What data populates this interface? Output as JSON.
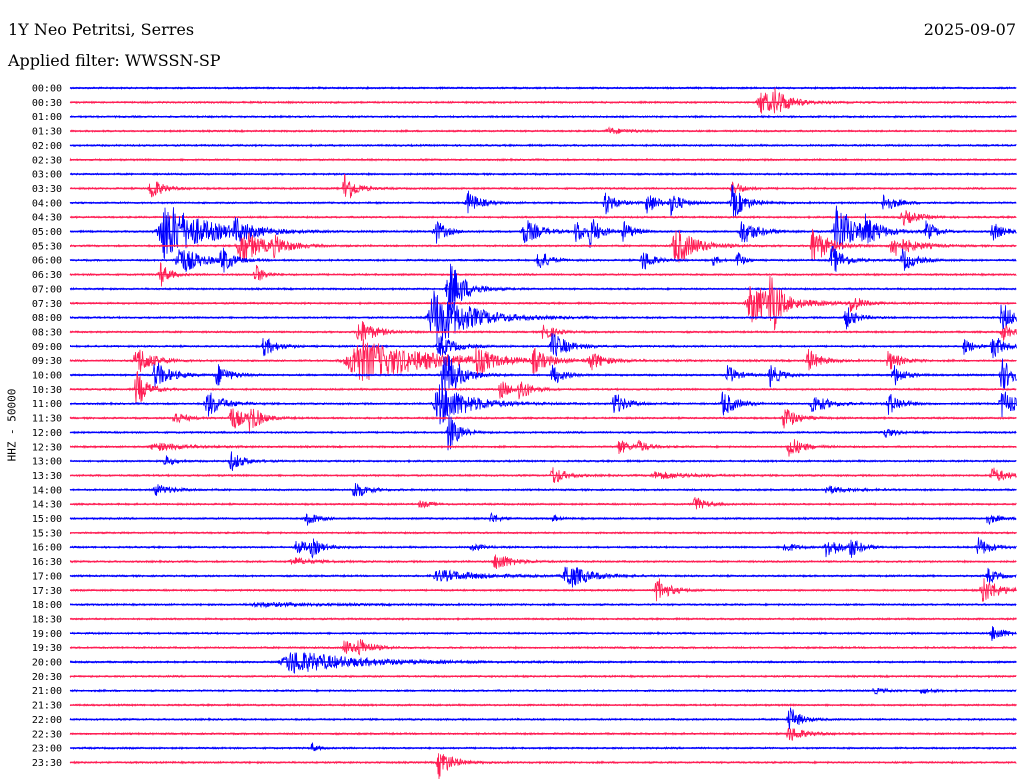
{
  "header": {
    "station": "1Y Neo Petritsi, Serres",
    "date": "2025-09-07",
    "filter": "Applied filter: WWSSN-SP"
  },
  "colors": {
    "odd": "#0000ff",
    "even": "#ff1f55"
  },
  "chart_data": {
    "type": "helicorder",
    "ylabel": "HHZ - 50000",
    "rows": [
      {
        "time": "00:00",
        "events": []
      },
      {
        "time": "00:30",
        "events": [
          {
            "x": 0.73,
            "amp": 12,
            "w": 0.02
          },
          {
            "x": 0.745,
            "amp": 10,
            "w": 0.012
          }
        ]
      },
      {
        "time": "01:00",
        "events": []
      },
      {
        "time": "01:30",
        "events": [
          {
            "x": 0.57,
            "amp": 3,
            "w": 0.02
          }
        ]
      },
      {
        "time": "02:00",
        "events": []
      },
      {
        "time": "02:30",
        "events": []
      },
      {
        "time": "03:00",
        "events": []
      },
      {
        "time": "03:30",
        "events": [
          {
            "x": 0.085,
            "amp": 14,
            "w": 0.01
          },
          {
            "x": 0.29,
            "amp": 18,
            "w": 0.01
          },
          {
            "x": 0.7,
            "amp": 8,
            "w": 0.01
          }
        ]
      },
      {
        "time": "04:00",
        "events": [
          {
            "x": 0.42,
            "amp": 12,
            "w": 0.012
          },
          {
            "x": 0.565,
            "amp": 14,
            "w": 0.01
          },
          {
            "x": 0.61,
            "amp": 12,
            "w": 0.01
          },
          {
            "x": 0.635,
            "amp": 12,
            "w": 0.01
          },
          {
            "x": 0.7,
            "amp": 18,
            "w": 0.012
          },
          {
            "x": 0.86,
            "amp": 10,
            "w": 0.012
          }
        ]
      },
      {
        "time": "04:30",
        "events": [
          {
            "x": 0.88,
            "amp": 8,
            "w": 0.015
          }
        ]
      },
      {
        "time": "05:00",
        "events": [
          {
            "x": 0.1,
            "amp": 30,
            "w": 0.04
          },
          {
            "x": 0.175,
            "amp": 10,
            "w": 0.015
          },
          {
            "x": 0.385,
            "amp": 14,
            "w": 0.01
          },
          {
            "x": 0.48,
            "amp": 14,
            "w": 0.015
          },
          {
            "x": 0.535,
            "amp": 12,
            "w": 0.01
          },
          {
            "x": 0.55,
            "amp": 14,
            "w": 0.01
          },
          {
            "x": 0.585,
            "amp": 10,
            "w": 0.01
          },
          {
            "x": 0.71,
            "amp": 14,
            "w": 0.015
          },
          {
            "x": 0.81,
            "amp": 30,
            "w": 0.018
          },
          {
            "x": 0.84,
            "amp": 12,
            "w": 0.015
          },
          {
            "x": 0.905,
            "amp": 10,
            "w": 0.01
          },
          {
            "x": 0.975,
            "amp": 10,
            "w": 0.01
          }
        ]
      },
      {
        "time": "05:30",
        "events": [
          {
            "x": 0.18,
            "amp": 20,
            "w": 0.02
          },
          {
            "x": 0.215,
            "amp": 8,
            "w": 0.015
          },
          {
            "x": 0.64,
            "amp": 20,
            "w": 0.02
          },
          {
            "x": 0.785,
            "amp": 20,
            "w": 0.015
          },
          {
            "x": 0.87,
            "amp": 12,
            "w": 0.02
          }
        ]
      },
      {
        "time": "06:00",
        "events": [
          {
            "x": 0.115,
            "amp": 16,
            "w": 0.02
          },
          {
            "x": 0.16,
            "amp": 14,
            "w": 0.01
          },
          {
            "x": 0.495,
            "amp": 12,
            "w": 0.01
          },
          {
            "x": 0.605,
            "amp": 12,
            "w": 0.01
          },
          {
            "x": 0.68,
            "amp": 6,
            "w": 0.005
          },
          {
            "x": 0.705,
            "amp": 10,
            "w": 0.006
          },
          {
            "x": 0.805,
            "amp": 16,
            "w": 0.012
          },
          {
            "x": 0.88,
            "amp": 12,
            "w": 0.012
          }
        ]
      },
      {
        "time": "06:30",
        "events": [
          {
            "x": 0.095,
            "amp": 14,
            "w": 0.008
          },
          {
            "x": 0.195,
            "amp": 12,
            "w": 0.008
          }
        ]
      },
      {
        "time": "07:00",
        "events": [
          {
            "x": 0.4,
            "amp": 30,
            "w": 0.015
          }
        ]
      },
      {
        "time": "07:30",
        "events": [
          {
            "x": 0.72,
            "amp": 20,
            "w": 0.03
          },
          {
            "x": 0.74,
            "amp": 40,
            "w": 0.006
          },
          {
            "x": 0.825,
            "amp": 10,
            "w": 0.01
          }
        ]
      },
      {
        "time": "08:00",
        "events": [
          {
            "x": 0.385,
            "amp": 30,
            "w": 0.035
          },
          {
            "x": 0.82,
            "amp": 12,
            "w": 0.01
          },
          {
            "x": 0.985,
            "amp": 16,
            "w": 0.012
          }
        ]
      },
      {
        "time": "08:30",
        "events": [
          {
            "x": 0.305,
            "amp": 14,
            "w": 0.015
          },
          {
            "x": 0.5,
            "amp": 10,
            "w": 0.01
          },
          {
            "x": 0.985,
            "amp": 10,
            "w": 0.01
          }
        ]
      },
      {
        "time": "09:00",
        "events": [
          {
            "x": 0.205,
            "amp": 10,
            "w": 0.012
          },
          {
            "x": 0.39,
            "amp": 12,
            "w": 0.015
          },
          {
            "x": 0.51,
            "amp": 14,
            "w": 0.015
          },
          {
            "x": 0.945,
            "amp": 8,
            "w": 0.01
          },
          {
            "x": 0.975,
            "amp": 14,
            "w": 0.01
          }
        ]
      },
      {
        "time": "09:30",
        "events": [
          {
            "x": 0.07,
            "amp": 16,
            "w": 0.015
          },
          {
            "x": 0.305,
            "amp": 22,
            "w": 0.07
          },
          {
            "x": 0.43,
            "amp": 14,
            "w": 0.012
          },
          {
            "x": 0.49,
            "amp": 12,
            "w": 0.012
          },
          {
            "x": 0.55,
            "amp": 10,
            "w": 0.012
          },
          {
            "x": 0.78,
            "amp": 12,
            "w": 0.012
          },
          {
            "x": 0.865,
            "amp": 10,
            "w": 0.012
          }
        ]
      },
      {
        "time": "10:00",
        "events": [
          {
            "x": 0.09,
            "amp": 14,
            "w": 0.015
          },
          {
            "x": 0.155,
            "amp": 12,
            "w": 0.012
          },
          {
            "x": 0.395,
            "amp": 30,
            "w": 0.015
          },
          {
            "x": 0.51,
            "amp": 12,
            "w": 0.01
          },
          {
            "x": 0.695,
            "amp": 10,
            "w": 0.01
          },
          {
            "x": 0.74,
            "amp": 12,
            "w": 0.01
          },
          {
            "x": 0.87,
            "amp": 12,
            "w": 0.01
          },
          {
            "x": 0.985,
            "amp": 16,
            "w": 0.015
          }
        ]
      },
      {
        "time": "10:30",
        "events": [
          {
            "x": 0.07,
            "amp": 20,
            "w": 0.01
          },
          {
            "x": 0.455,
            "amp": 10,
            "w": 0.01
          },
          {
            "x": 0.475,
            "amp": 12,
            "w": 0.01
          }
        ]
      },
      {
        "time": "11:00",
        "events": [
          {
            "x": 0.145,
            "amp": 14,
            "w": 0.015
          },
          {
            "x": 0.39,
            "amp": 22,
            "w": 0.03
          },
          {
            "x": 0.575,
            "amp": 12,
            "w": 0.012
          },
          {
            "x": 0.69,
            "amp": 14,
            "w": 0.012
          },
          {
            "x": 0.785,
            "amp": 10,
            "w": 0.015
          },
          {
            "x": 0.865,
            "amp": 12,
            "w": 0.012
          },
          {
            "x": 0.985,
            "amp": 14,
            "w": 0.015
          }
        ]
      },
      {
        "time": "11:30",
        "events": [
          {
            "x": 0.11,
            "amp": 8,
            "w": 0.01
          },
          {
            "x": 0.17,
            "amp": 14,
            "w": 0.012
          },
          {
            "x": 0.19,
            "amp": 14,
            "w": 0.01
          },
          {
            "x": 0.755,
            "amp": 12,
            "w": 0.012
          }
        ]
      },
      {
        "time": "12:00",
        "events": [
          {
            "x": 0.4,
            "amp": 20,
            "w": 0.01
          },
          {
            "x": 0.86,
            "amp": 6,
            "w": 0.01
          }
        ]
      },
      {
        "time": "12:30",
        "events": [
          {
            "x": 0.09,
            "amp": 4,
            "w": 0.03
          },
          {
            "x": 0.58,
            "amp": 8,
            "w": 0.01
          },
          {
            "x": 0.6,
            "amp": 6,
            "w": 0.01
          },
          {
            "x": 0.76,
            "amp": 12,
            "w": 0.012
          }
        ]
      },
      {
        "time": "13:00",
        "events": [
          {
            "x": 0.1,
            "amp": 6,
            "w": 0.008
          },
          {
            "x": 0.17,
            "amp": 10,
            "w": 0.012
          }
        ]
      },
      {
        "time": "13:30",
        "events": [
          {
            "x": 0.51,
            "amp": 10,
            "w": 0.012
          },
          {
            "x": 0.62,
            "amp": 4,
            "w": 0.03
          },
          {
            "x": 0.975,
            "amp": 8,
            "w": 0.015
          }
        ]
      },
      {
        "time": "14:00",
        "events": [
          {
            "x": 0.09,
            "amp": 6,
            "w": 0.015
          },
          {
            "x": 0.3,
            "amp": 10,
            "w": 0.012
          },
          {
            "x": 0.8,
            "amp": 4,
            "w": 0.02
          }
        ]
      },
      {
        "time": "14:30",
        "events": [
          {
            "x": 0.37,
            "amp": 4,
            "w": 0.01
          },
          {
            "x": 0.66,
            "amp": 8,
            "w": 0.01
          }
        ]
      },
      {
        "time": "15:00",
        "events": [
          {
            "x": 0.25,
            "amp": 8,
            "w": 0.01
          },
          {
            "x": 0.445,
            "amp": 6,
            "w": 0.008
          },
          {
            "x": 0.51,
            "amp": 4,
            "w": 0.005
          },
          {
            "x": 0.97,
            "amp": 6,
            "w": 0.01
          }
        ]
      },
      {
        "time": "15:30",
        "events": []
      },
      {
        "time": "16:00",
        "events": [
          {
            "x": 0.24,
            "amp": 8,
            "w": 0.012
          },
          {
            "x": 0.255,
            "amp": 8,
            "w": 0.01
          },
          {
            "x": 0.425,
            "amp": 4,
            "w": 0.01
          },
          {
            "x": 0.755,
            "amp": 6,
            "w": 0.01
          },
          {
            "x": 0.8,
            "amp": 12,
            "w": 0.012
          },
          {
            "x": 0.825,
            "amp": 10,
            "w": 0.01
          },
          {
            "x": 0.96,
            "amp": 10,
            "w": 0.012
          }
        ]
      },
      {
        "time": "16:30",
        "events": [
          {
            "x": 0.235,
            "amp": 4,
            "w": 0.02
          },
          {
            "x": 0.45,
            "amp": 10,
            "w": 0.015
          }
        ]
      },
      {
        "time": "17:00",
        "events": [
          {
            "x": 0.39,
            "amp": 6,
            "w": 0.04
          },
          {
            "x": 0.525,
            "amp": 14,
            "w": 0.02
          },
          {
            "x": 0.97,
            "amp": 8,
            "w": 0.01
          }
        ]
      },
      {
        "time": "17:30",
        "events": [
          {
            "x": 0.62,
            "amp": 14,
            "w": 0.012
          },
          {
            "x": 0.965,
            "amp": 14,
            "w": 0.015
          }
        ]
      },
      {
        "time": "18:00",
        "events": [
          {
            "x": 0.2,
            "amp": 2,
            "w": 0.06
          }
        ]
      },
      {
        "time": "18:30",
        "events": []
      },
      {
        "time": "19:00",
        "events": [
          {
            "x": 0.975,
            "amp": 8,
            "w": 0.012
          }
        ]
      },
      {
        "time": "19:30",
        "events": [
          {
            "x": 0.29,
            "amp": 8,
            "w": 0.012
          },
          {
            "x": 0.305,
            "amp": 8,
            "w": 0.012
          }
        ]
      },
      {
        "time": "20:00",
        "events": [
          {
            "x": 0.235,
            "amp": 12,
            "w": 0.06
          }
        ]
      },
      {
        "time": "20:30",
        "events": []
      },
      {
        "time": "21:00",
        "events": [
          {
            "x": 0.85,
            "amp": 3,
            "w": 0.01
          },
          {
            "x": 0.9,
            "amp": 3,
            "w": 0.01
          }
        ]
      },
      {
        "time": "21:30",
        "events": []
      },
      {
        "time": "22:00",
        "events": [
          {
            "x": 0.76,
            "amp": 14,
            "w": 0.01
          }
        ]
      },
      {
        "time": "22:30",
        "events": [
          {
            "x": 0.76,
            "amp": 8,
            "w": 0.015
          }
        ]
      },
      {
        "time": "23:00",
        "events": [
          {
            "x": 0.255,
            "amp": 6,
            "w": 0.005
          }
        ]
      },
      {
        "time": "23:30",
        "events": [
          {
            "x": 0.39,
            "amp": 16,
            "w": 0.012
          }
        ]
      }
    ]
  }
}
